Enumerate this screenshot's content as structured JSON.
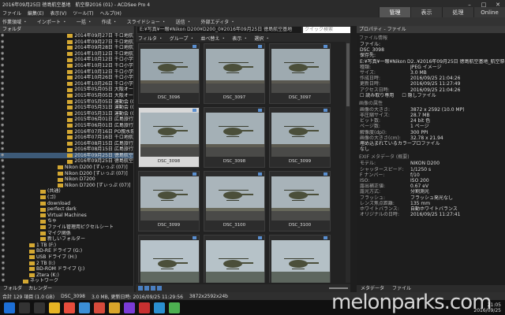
{
  "window": {
    "title": "2016年09月25日 徳島航空基地　航空祭2016 (01) - ACDSee Pro 4"
  },
  "menu": [
    "ファイル",
    "編集(E)",
    "表示(V)",
    "ツール(T)",
    "ヘルプ(H)"
  ],
  "modes": [
    {
      "label": "管理",
      "active": true
    },
    {
      "label": "表示",
      "active": false
    },
    {
      "label": "処理",
      "active": false
    },
    {
      "label": "Online",
      "active": false
    }
  ],
  "toolbar": [
    "作業領域 ・",
    "インポート ・",
    "一括 ・",
    "作成 ・",
    "スライドショー ・",
    "送信 ・",
    "外部エディタ ・"
  ],
  "folders": {
    "header": "フォルダ",
    "rows": [
      {
        "label": "2014年09月27日 千ロ地航空...",
        "indent": 80
      },
      {
        "label": "2014年09月27日 千ロ地航空...",
        "indent": 80
      },
      {
        "label": "2014年09月28日 千ロ地航空...",
        "indent": 80
      },
      {
        "label": "2014年10月12日 千ロ地航空...",
        "indent": 80
      },
      {
        "label": "2014年10月12日 千ロ小学校...",
        "indent": 80
      },
      {
        "label": "2014年10月12日 千ロ小学校...",
        "indent": 80
      },
      {
        "label": "2014年10月12日 千ロ小学校...",
        "indent": 80
      },
      {
        "label": "2014年10月26日 千ロ小学校...",
        "indent": 80
      },
      {
        "label": "2014年10月26日 千ロ小学校...",
        "indent": 80
      },
      {
        "label": "2015年05月05日 大阪オートレ...",
        "indent": 80
      },
      {
        "label": "2015年05月05日 大阪オートレ...",
        "indent": 80
      },
      {
        "label": "2015年05月05日 運動会 (01)",
        "indent": 80
      },
      {
        "label": "2015年05月31日 運動会 (02)",
        "indent": 80
      },
      {
        "label": "2015年05月31日 運動会 (03)",
        "indent": 80
      },
      {
        "label": "2015年06月01日 広島旅行...",
        "indent": 80
      },
      {
        "label": "2015年06月01日 広島旅行...",
        "indent": 80
      },
      {
        "label": "2016年07月16日 PO親水祭...",
        "indent": 80
      },
      {
        "label": "2016年07月16日 千ロ地航空...",
        "indent": 80
      },
      {
        "label": "2016年08月15日 広島旅行...",
        "indent": 80
      },
      {
        "label": "2016年08月15日 広島旅行...",
        "indent": 80
      },
      {
        "label": "2016年09月25日 徳島航空基...",
        "indent": 80,
        "selected": true
      },
      {
        "label": "2016年09月25日 徳島航空基...",
        "indent": 80
      },
      {
        "label": "Nikon D200 [ずぃっぷ (07)]",
        "indent": 66
      },
      {
        "label": "Nikon D200 [ずぃっぷ (07)]",
        "indent": 66
      },
      {
        "label": "Nikon D7200",
        "indent": 66
      },
      {
        "label": "Nikon D7200 [ずぃっぷ (07)]",
        "indent": 66
      },
      {
        "label": "(共通)",
        "indent": 44
      },
      {
        "label": "(ゴ)",
        "indent": 44
      },
      {
        "label": "download",
        "indent": 44
      },
      {
        "label": "perfect dark",
        "indent": 44
      },
      {
        "label": "Virtual Machines",
        "indent": 44
      },
      {
        "label": "ちゃ",
        "indent": 44
      },
      {
        "label": "ファイル管理用ピクセルシート",
        "indent": 44
      },
      {
        "label": "マイク関係",
        "indent": 44
      },
      {
        "label": "新しいフォルダー",
        "indent": 44
      },
      {
        "label": "1 TB (F:)",
        "indent": 30
      },
      {
        "label": "BD-RE ドライブ (G:)",
        "indent": 30
      },
      {
        "label": "USB ドライブ (H:)",
        "indent": 30
      },
      {
        "label": "2 TB (I:)",
        "indent": 30
      },
      {
        "label": "BD-ROM ドライブ (J:)",
        "indent": 30
      },
      {
        "label": "Ztera (K:)",
        "indent": 30
      },
      {
        "label": "ネットワーク",
        "indent": 22
      }
    ]
  },
  "left_tabs": [
    "フォルダ",
    "カレンダー"
  ],
  "browser": {
    "path": "E:¥写真¥一眼¥Nikon D200¥D200_0¥2016年09月25日 徳島航空基地",
    "search_placeholder": "クイック検索",
    "filters": [
      "フィルタ ・",
      "グループ ・",
      "並べ替え ・",
      "表示 ・",
      "選択 ・"
    ],
    "thumbnails": [
      {
        "name": "DSC_3096",
        "sky": "#9aa7ae",
        "ground": "#5e5a4e",
        "heli": true,
        "crowd": true,
        "highlight": false
      },
      {
        "name": "DSC_3097",
        "sky": "#a1adb3",
        "ground": "#5c5a50",
        "heli": true,
        "crowd": true,
        "highlight": false
      },
      {
        "name": "DSC_3097",
        "sky": "#9eaab0",
        "ground": "#5a5850",
        "heli": true,
        "crowd": true,
        "highlight": false
      },
      {
        "name": "DSC_3098",
        "sky": "#a8b4ba",
        "ground": "#5b5a52",
        "heli": true,
        "crowd": true,
        "highlight": true
      },
      {
        "name": "DSC_3098",
        "sky": "#a4b0b6",
        "ground": "#5e5c52",
        "heli": true,
        "crowd": true,
        "highlight": false
      },
      {
        "name": "DSC_3099",
        "sky": "#a3afb5",
        "ground": "#5c5a50",
        "heli": true,
        "crowd": true,
        "highlight": false
      },
      {
        "name": "DSC_3099",
        "sky": "#a9b4ba",
        "ground": "#6a6a5c",
        "heli": true,
        "crowd": true,
        "highlight": false
      },
      {
        "name": "DSC_3100",
        "sky": "#aab5bb",
        "ground": "#696a5d",
        "heli": true,
        "crowd": true,
        "highlight": false
      },
      {
        "name": "DSC_3100",
        "sky": "#a8b3b9",
        "ground": "#67685b",
        "heli": true,
        "crowd": true,
        "highlight": false
      },
      {
        "name": "",
        "sky": "#b7c3ca",
        "ground": "#5f6860",
        "heli": true,
        "crowd": false,
        "highlight": false
      },
      {
        "name": "",
        "sky": "#b6c2c8",
        "ground": "#5e675f",
        "heli": true,
        "crowd": false,
        "highlight": false
      },
      {
        "name": "",
        "sky": "#b4c0c6",
        "ground": "#5d665e",
        "heli": true,
        "crowd": false,
        "highlight": false
      }
    ]
  },
  "properties": {
    "header": "プロパティ - ファイル",
    "file_section": "ファイル情報",
    "file_label": "ファイル:",
    "file_name": "DSC_3098",
    "location_label": "保存先:",
    "location": "E:¥写真¥一眼¥Nikon D2..¥2016年09月25日 徳島航空基地_航空祭2016 (01)",
    "file_rows": [
      {
        "k": "種類:",
        "v": "JPEG イメージ"
      },
      {
        "k": "サイズ:",
        "v": "3.0 MB"
      },
      {
        "k": "作成日時:",
        "v": "2016/09/25 21:04:26"
      },
      {
        "k": "更新日時:",
        "v": "2016/09/25 11:27:49"
      },
      {
        "k": "アクセス日時:",
        "v": "2016/09/25 21:04:26"
      }
    ],
    "checks": [
      "読み取り専用",
      "隠しファイル"
    ],
    "image_section": "画像の属性",
    "image_rows": [
      {
        "k": "画像の大きさ:",
        "v": "3872 x 2592 (10.0 MP)"
      },
      {
        "k": "非圧縮サイズ:",
        "v": "28.7 MB"
      },
      {
        "k": "ビット数:",
        "v": "24 bit 色"
      },
      {
        "k": "ページ数:",
        "v": "1 ページ"
      },
      {
        "k": "解像度(dpi):",
        "v": "300 PPI"
      },
      {
        "k": "画像の大きさ(cm):",
        "v": "32.78 x 21.94"
      }
    ],
    "embed_label": "埋め込まれているカラープロファイル",
    "embed_value": "なし",
    "exif_section": "EXIF メタデータ (概要)",
    "exif_rows": [
      {
        "k": "モデル:",
        "v": "NIKON D200"
      },
      {
        "k": "シャッタースピード:",
        "v": "1/1250 s"
      },
      {
        "k": "F ナンバー:",
        "v": "f/10"
      },
      {
        "k": "ISO:",
        "v": "ISO 200"
      },
      {
        "k": "露出補正値:",
        "v": "0.67 eV"
      },
      {
        "k": "露光方式:",
        "v": "分割測光"
      },
      {
        "k": "フラッシュ:",
        "v": "フラッシュ発光なし"
      },
      {
        "k": "レンズ焦点距離:",
        "v": "135 mm"
      },
      {
        "k": "ホワイトバランス:",
        "v": "自動ホワイトバランス"
      },
      {
        "k": "オリジナルの日時:",
        "v": "2016/09/25 11:27:41"
      }
    ],
    "tabs": [
      "メタデータ",
      "ファイル"
    ]
  },
  "status": [
    "合計 129 項目 (1.0 GB)",
    "DSC_3098",
    "3.0 MB, 更新日時: 2016/09/25 11:29:56",
    "3872x2592x24b"
  ],
  "taskbar": {
    "icons": [
      {
        "name": "windows-icon",
        "color": "#1d6fd6"
      },
      {
        "name": "search-icon",
        "color": "#333333"
      },
      {
        "name": "task-view-icon",
        "color": "#333333"
      },
      {
        "name": "explorer-icon",
        "color": "#e6b424"
      },
      {
        "name": "chrome-icon",
        "color": "#e74c3c"
      },
      {
        "name": "app-icon-1",
        "color": "#3b8ed6"
      },
      {
        "name": "app-icon-2",
        "color": "#d64a3b"
      },
      {
        "name": "app-icon-3",
        "color": "#d9a52a"
      },
      {
        "name": "app-icon-4",
        "color": "#7a3bd6"
      },
      {
        "name": "app-icon-5",
        "color": "#c63030"
      },
      {
        "name": "acdsee-icon",
        "color": "#2a8fd0"
      },
      {
        "name": "app-icon-6",
        "color": "#4caf50"
      }
    ],
    "time": "21:05",
    "date": "2016/09/25"
  },
  "watermark": "melonparks.com"
}
